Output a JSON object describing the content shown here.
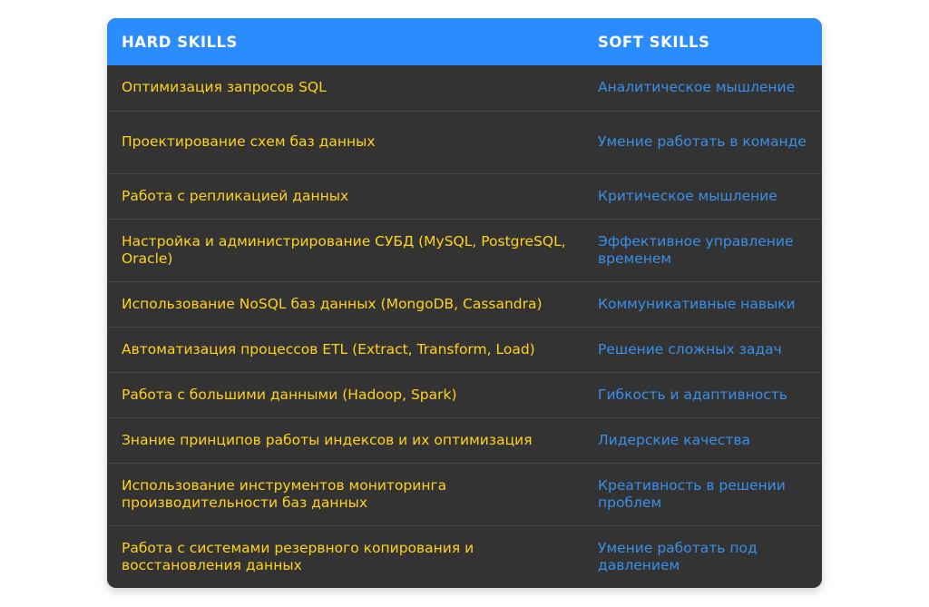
{
  "colors": {
    "header_bg": "#2b8cff",
    "header_text": "#ffffff",
    "body_bg": "#333333",
    "hard_text": "#ffd21c",
    "soft_text": "#3a8fe8"
  },
  "headers": {
    "hard": "HARD SKILLS",
    "soft": "SOFT SKILLS"
  },
  "rows": [
    {
      "hard": "Оптимизация запросов SQL",
      "soft": "Аналитическое мышление"
    },
    {
      "hard": "Проектирование схем баз данных",
      "soft": "Умение работать в команде"
    },
    {
      "hard": "Работа с репликацией данных",
      "soft": "Критическое мышление"
    },
    {
      "hard": "Настройка и администрирование СУБД (MySQL, PostgreSQL, Oracle)",
      "soft": "Эффективное управление временем"
    },
    {
      "hard": "Использование NoSQL баз данных (MongoDB, Cassandra)",
      "soft": "Коммуникативные навыки"
    },
    {
      "hard": "Автоматизация процессов ETL (Extract, Transform, Load)",
      "soft": "Решение сложных задач"
    },
    {
      "hard": "Работа с большими данными (Hadoop, Spark)",
      "soft": "Гибкость и адаптивность"
    },
    {
      "hard": "Знание принципов работы индексов и их оптимизация",
      "soft": "Лидерские качества"
    },
    {
      "hard": "Использование инструментов мониторинга производительности баз данных",
      "soft": "Креативность в решении проблем"
    },
    {
      "hard": "Работа с системами резервного копирования и восстановления данных",
      "soft": "Умение работать под давлением"
    }
  ]
}
